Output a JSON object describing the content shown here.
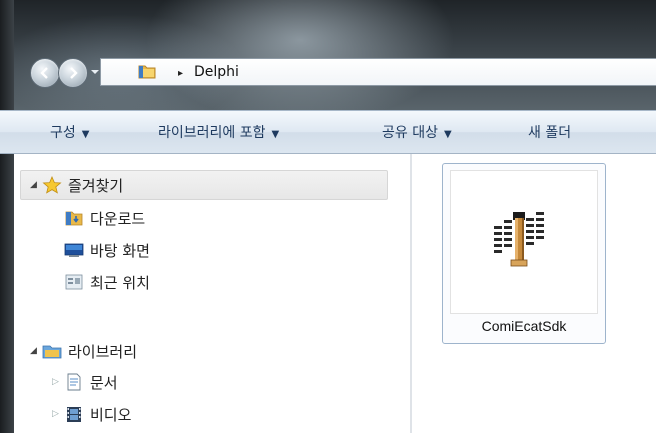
{
  "address": {
    "path": "Delphi",
    "separator": "▸"
  },
  "toolbar": {
    "organize": "구성",
    "include_library": "라이브러리에 포함",
    "share_with": "공유 대상",
    "new_folder": "새 폴더",
    "caret": "▼"
  },
  "nav": {
    "favorites": {
      "label": "즐겨찾기",
      "items": [
        {
          "label": "다운로드",
          "icon": "downloads-folder-icon"
        },
        {
          "label": "바탕 화면",
          "icon": "desktop-icon"
        },
        {
          "label": "최근 위치",
          "icon": "recent-places-icon"
        }
      ]
    },
    "libraries": {
      "label": "라이브러리",
      "items": [
        {
          "label": "문서",
          "icon": "documents-icon"
        },
        {
          "label": "비디오",
          "icon": "videos-icon"
        }
      ]
    }
  },
  "files": [
    {
      "name": "ComiEcatSdk",
      "icon": "delphi-project-icon"
    }
  ],
  "colors": {
    "toolbar_text": "#1e3a5f",
    "selection_border": "#9eb4cc",
    "favorites_highlight": "#e9e9e9"
  }
}
